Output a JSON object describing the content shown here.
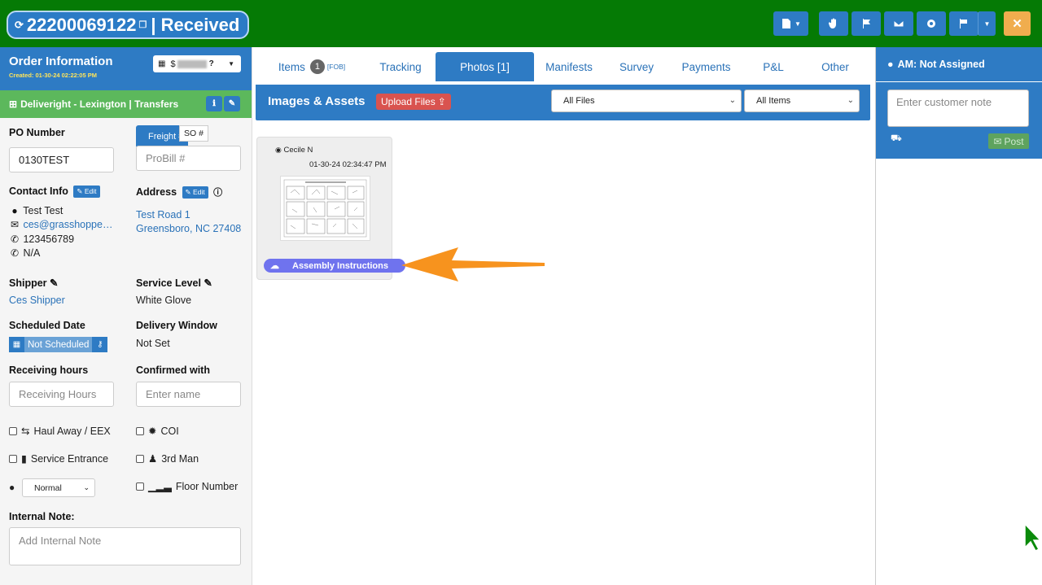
{
  "header": {
    "order_number": "22200069122",
    "status": "| Received",
    "buttons": [
      "document-dropdown",
      "hand-icon",
      "flag-icon",
      "envelope-icon",
      "gear-icon",
      "route-icon",
      "dropdown",
      "close-icon"
    ]
  },
  "left": {
    "order_info_title": "Order Information",
    "created": "Created: 01-30-24 02:22:05 PM",
    "price_select": "$",
    "customer_bar": "Deliveright - Lexington | Transfers",
    "po_label": "PO Number",
    "po_value": "0130TEST",
    "freight_tab": "Freight #",
    "so_tab": "SO #",
    "probill_placeholder": "ProBill #",
    "contact_label": "Contact Info",
    "edit_label": "Edit",
    "address_label": "Address",
    "contact_name": "Test Test",
    "contact_email": "ces@grasshoppe…",
    "contact_phone": "123456789",
    "contact_alt": "N/A",
    "address_line1": "Test Road 1",
    "address_line2": "Greensboro, NC 27408",
    "shipper_label": "Shipper",
    "shipper_value": "Ces Shipper",
    "service_label": "Service Level",
    "service_value": "White Glove",
    "scheduled_label": "Scheduled Date",
    "scheduled_value": "Not Scheduled",
    "window_label": "Delivery Window",
    "window_value": "Not Set",
    "receiving_label": "Receiving hours",
    "receiving_placeholder": "Receiving Hours",
    "confirmed_label": "Confirmed with",
    "confirmed_placeholder": "Enter name",
    "haul_label": "Haul Away / EEX",
    "coi_label": "COI",
    "service_entrance_label": "Service Entrance",
    "third_man_label": "3rd Man",
    "priority_value": "Normal",
    "floor_label": "Floor Number",
    "internal_note_label": "Internal Note:",
    "internal_note_placeholder": "Add Internal Note"
  },
  "center": {
    "tabs": {
      "items": "Items",
      "items_count": "1",
      "items_sup": "[FOB]",
      "tracking": "Tracking",
      "photos": "Photos [1]",
      "manifests": "Manifests",
      "survey": "Survey",
      "payments": "Payments",
      "pl": "P&L",
      "other": "Other"
    },
    "assets_title": "Images & Assets",
    "upload_label": "Upload Files",
    "filter_files": "All Files",
    "filter_items": "All Items",
    "card": {
      "user": "Cecile N",
      "date": "01-30-24 02:34:47 PM",
      "label": "Assembly Instructions"
    }
  },
  "right": {
    "am_label": "AM: Not Assigned",
    "note_placeholder": "Enter customer note",
    "post_label": "Post"
  },
  "colors": {
    "topbar": "#057a05",
    "primary": "#2e7bc4",
    "success": "#5cb85c",
    "danger": "#d9534f",
    "warning": "#f0ad4e",
    "tag": "#6f73ee",
    "arrow": "#f7931e"
  }
}
